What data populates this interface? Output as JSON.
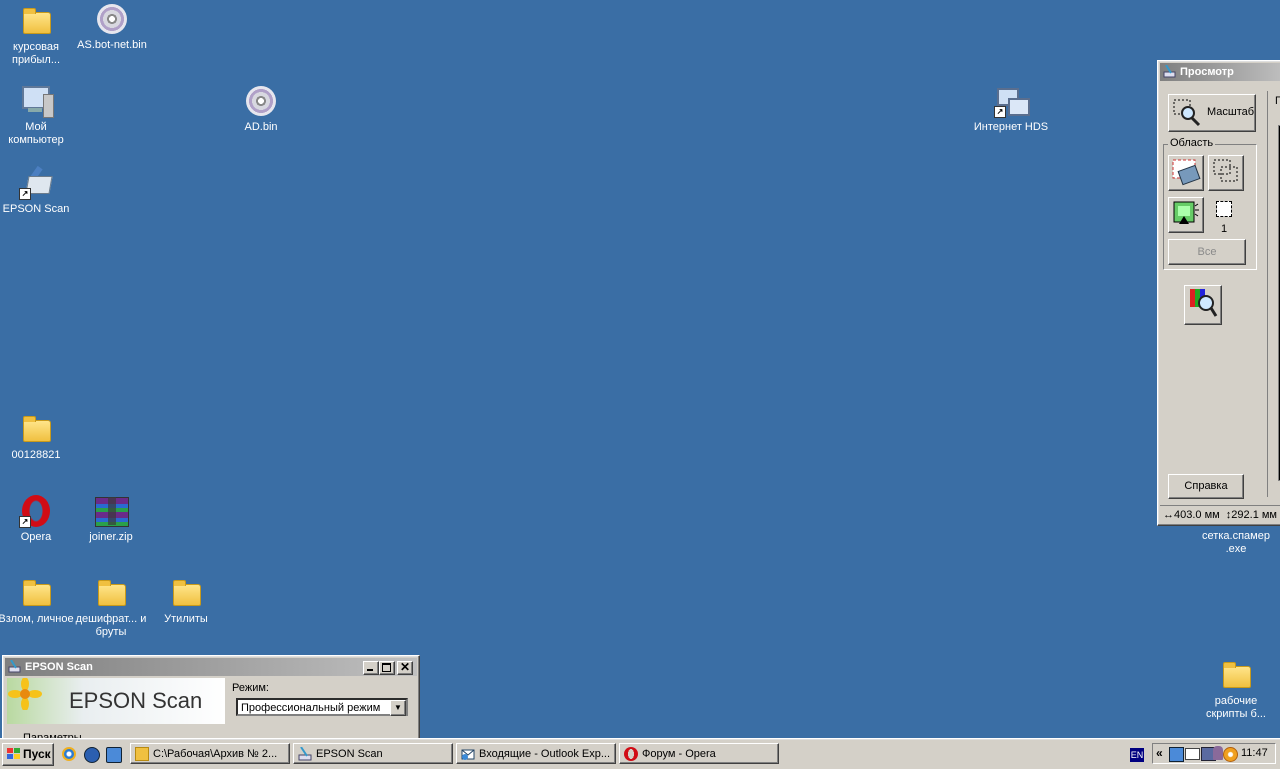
{
  "desktop_icons": {
    "kursovaya": "курсовая прибыл...",
    "as_botnet": "AS.bot-net.bin",
    "my_computer": "Мой компьютер",
    "ad_bin": "AD.bin",
    "internet_hds": "Интернет HDS",
    "epson_scan": "EPSON Scan",
    "folder_00128821": "00128821",
    "opera": "Opera",
    "joiner": "joiner.zip",
    "vzlom": "Взлом, личное",
    "deshifrat": "дешифрат... и бруты",
    "utility": "Утилиты",
    "setka": "сетка.спамер .exe",
    "rabochie": "рабочие скрипты б..."
  },
  "preview_window": {
    "title": "Просмотр",
    "zoom_label": "Масштаб",
    "area_group_label": "Область",
    "marquee_count": "1",
    "all_button": "Все",
    "help_button": "Справка",
    "width_readout": "403.0 мм",
    "height_readout": "292.1 мм",
    "right_fragment": "П"
  },
  "epson_window": {
    "title": "EPSON Scan",
    "logo_text": "EPSON Scan",
    "mode_label": "Режим:",
    "mode_value": "Профессиональный режим",
    "params_label": "Параметры"
  },
  "taskbar": {
    "start_label": "Пуск",
    "tasks": [
      "C:\\Рабочая\\Архив № 2...",
      "EPSON Scan",
      "Входящие - Outlook Exp...",
      "Форум - Opera"
    ],
    "lang": "EN",
    "tray_arrow": "«",
    "clock": "11:47"
  },
  "colors": {
    "desktop": "#3a6ea5",
    "face": "#d4d0c8",
    "inactive_title_start": "#7f7f7f",
    "inactive_title_end": "#c0c0c0"
  }
}
